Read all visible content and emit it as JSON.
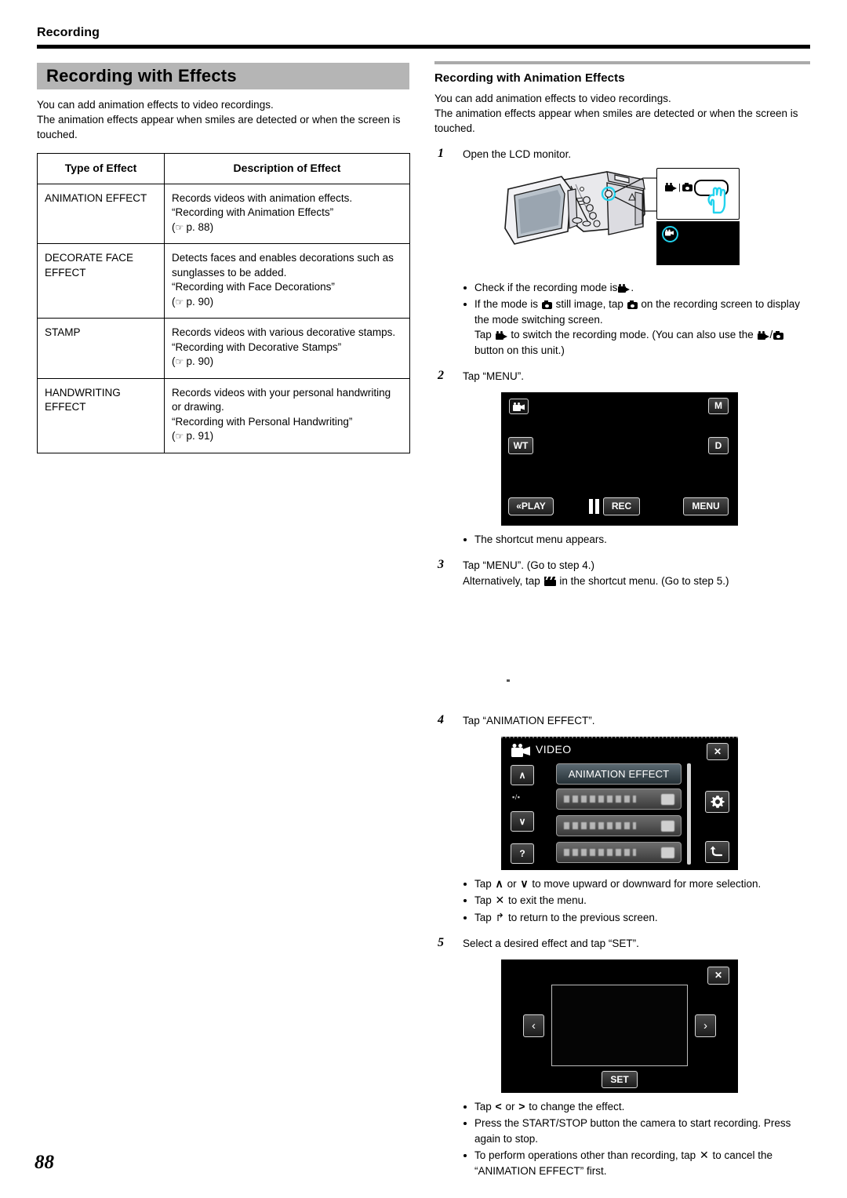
{
  "running_head": "Recording",
  "page_number": "88",
  "left": {
    "title": "Recording with Effects",
    "intro_line1": "You can add animation effects to video recordings.",
    "intro_line2": "The animation effects appear when smiles are detected or when the screen is touched.",
    "table": {
      "headers": [
        "Type of Effect",
        "Description of Effect"
      ],
      "rows": [
        {
          "type": "ANIMATION EFFECT",
          "desc_line1": "Records videos with animation effects.",
          "desc_line2": "“Recording with Animation Effects”",
          "page_ref": "p. 88"
        },
        {
          "type": "DECORATE FACE EFFECT",
          "desc_line1": "Detects faces and enables decorations such as sunglasses to be added.",
          "desc_line2": "“Recording with Face Decorations”",
          "page_ref": "p. 90"
        },
        {
          "type": "STAMP",
          "desc_line1": "Records videos with various decorative stamps.",
          "desc_line2": "“Recording with Decorative Stamps”",
          "page_ref": "p. 90"
        },
        {
          "type": "HANDWRITING EFFECT",
          "desc_line1": "Records videos with your personal handwriting or drawing.",
          "desc_line2": "“Recording with Personal Handwriting”",
          "page_ref": "p. 91"
        }
      ]
    }
  },
  "right": {
    "subtitle": "Recording with Animation Effects",
    "intro_line1": "You can add animation effects to video recordings.",
    "intro_line2": "The animation effects appear when smiles are detected or when the screen is touched.",
    "step1": {
      "num": "1",
      "text": "Open the LCD monitor.",
      "bullet1_a": "Check if the recording mode is",
      "bullet1_b": ".",
      "bullet2_a": "If the mode is",
      "bullet2_b": "still image, tap",
      "bullet2_c": "on the recording screen to display the mode switching screen.",
      "bullet2_d": "Tap",
      "bullet2_e": "to switch the recording mode. (You can also use the",
      "bullet2_f": "/",
      "bullet2_g": "button on this unit.)"
    },
    "step2": {
      "num": "2",
      "text": "Tap “MENU”.",
      "bullet": "The shortcut menu appears."
    },
    "step3": {
      "num": "3",
      "line1": "Tap “MENU”. (Go to step 4.)",
      "line2_a": "Alternatively, tap",
      "line2_b": "in the shortcut menu. (Go to step 5.)"
    },
    "step4": {
      "num": "4",
      "text": "Tap “ANIMATION EFFECT”.",
      "bullet1_a": "Tap",
      "bullet1_or": "or",
      "bullet1_b": "to move upward or downward for more selection.",
      "bullet2_a": "Tap",
      "bullet2_b": "to exit the menu.",
      "bullet3_a": "Tap",
      "bullet3_b": "to return to the previous screen."
    },
    "step5": {
      "num": "5",
      "text": "Select a desired effect and tap “SET”.",
      "bullet1_a": "Tap",
      "bullet1_or": "or",
      "bullet1_b": "to change the effect.",
      "bullet2": "Press the START/STOP button the camera to start recording. Press again to stop.",
      "bullet3_a": "To perform operations other than recording, tap",
      "bullet3_b": "to cancel the “ANIMATION EFFECT” first."
    },
    "screen_recording": {
      "play_label": "«PLAY",
      "rec_label": "REC",
      "menu_label": "MENU",
      "m_label": "M",
      "d_label": "D",
      "wt_label": "WT"
    },
    "screen_menu": {
      "title": "VIDEO",
      "selected_item": "ANIMATION EFFECT",
      "page_indicator": "▪/▪",
      "help_label": "?",
      "close_label": "✕",
      "up_label": "∧",
      "down_label": "∨"
    },
    "screen_effect": {
      "set_label": "SET",
      "close_label": "✕",
      "left_label": "‹",
      "right_label": "›"
    }
  },
  "colors": {
    "title_band": "#b5b5b5",
    "sub_rule": "#aaaaaa",
    "highlight_cyan": "#22d3ee",
    "screen_bg": "#000000"
  }
}
